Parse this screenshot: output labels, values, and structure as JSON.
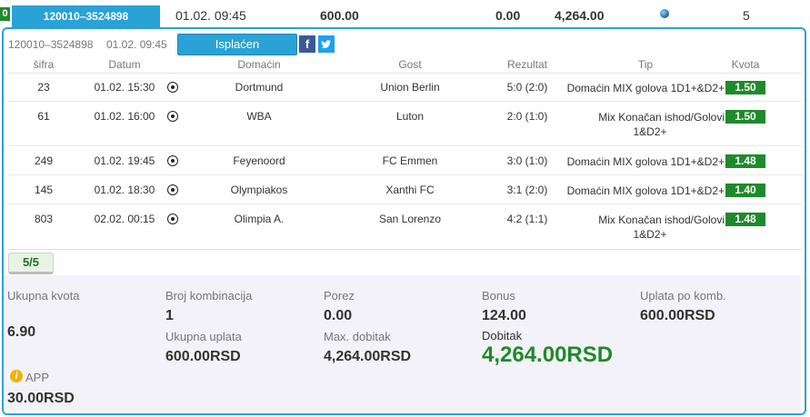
{
  "ticket": {
    "status_badge": "0",
    "id": "120010–3524898",
    "date": "01.02. 09:45",
    "stake": "600.00",
    "tax": "0.00",
    "payout": "4,264.00",
    "count": "5",
    "status_color": "#1f8a2b",
    "accent_color": "#2aa2d6"
  },
  "panel": {
    "id": "120010–3524898",
    "date": "01.02. 09:45",
    "paid_button": "Isplaćen",
    "fb_icon": "facebook-icon",
    "tw_icon": "twitter-icon"
  },
  "table": {
    "headers": {
      "code": "šifra",
      "date": "Datum",
      "home": "Domaćin",
      "away": "Gost",
      "result": "Rezultat",
      "tip": "Tip",
      "odds": "Kvota"
    },
    "rows": [
      {
        "code": "23",
        "date": "01.02. 15:30",
        "home": "Dortmund",
        "away": "Union Berlin",
        "result": "5:0 (2:0)",
        "tip": "Domaćin MIX golova 1D1+&D2+",
        "odds": "1.50"
      },
      {
        "code": "61",
        "date": "01.02. 16:00",
        "home": "WBA",
        "away": "Luton",
        "result": "2:0 (1:0)",
        "tip_line1": "Mix Konačan ishod/Golovi",
        "tip_line2": "1&D2+",
        "odds": "1.50"
      },
      {
        "code": "249",
        "date": "01.02. 19:45",
        "home": "Feyenoord",
        "away": "FC Emmen",
        "result": "3:0 (1:0)",
        "tip": "Domaćin MIX golova 1D1+&D2+",
        "odds": "1.48"
      },
      {
        "code": "145",
        "date": "01.02. 18:30",
        "home": "Olympiakos",
        "away": "Xanthi FC",
        "result": "3:1 (2:0)",
        "tip": "Domaćin MIX golova 1D1+&D2+",
        "odds": "1.40"
      },
      {
        "code": "803",
        "date": "02.02. 00:15",
        "home": "Olimpia A.",
        "away": "San Lorenzo",
        "result": "4:2 (1:1)",
        "tip_line1": "Mix Konačan ishod/Golovi",
        "tip_line2": "1&D2+",
        "odds": "1.48"
      }
    ]
  },
  "combo_tab": "5/5",
  "summary": {
    "total_odds_label": "Ukupna kvota",
    "total_odds": "6.90",
    "combinations_label": "Broj kombinacija",
    "combinations": "1",
    "total_stake_label": "Ukupna uplata",
    "total_stake": "600.00RSD",
    "tax_label": "Porez",
    "tax": "0.00",
    "max_win_label": "Max. dobitak",
    "max_win": "4,264.00RSD",
    "bonus_label": "Bonus",
    "bonus": "124.00",
    "win_label": "Dobitak",
    "win": "4,264.00RSD",
    "per_comb_label": "Uplata po komb.",
    "per_comb": "600.00RSD",
    "app_label": "APP",
    "app_value": "30.00RSD",
    "info_icon": "i"
  }
}
